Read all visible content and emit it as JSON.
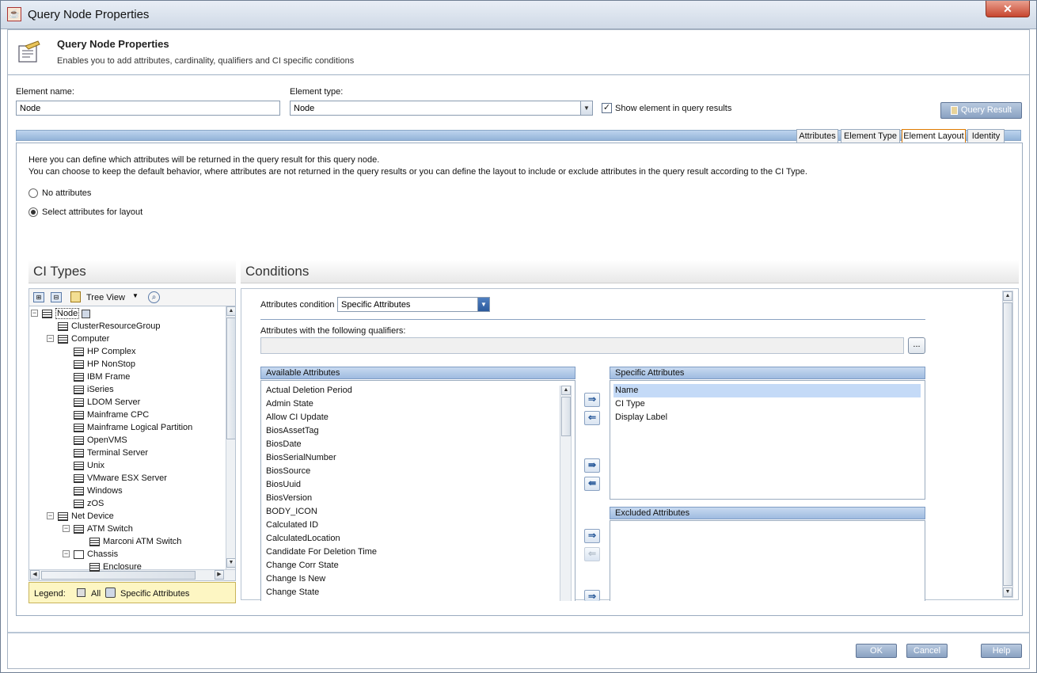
{
  "window": {
    "title": "Query Node Properties",
    "close_label": "✕"
  },
  "header": {
    "title": "Query Node Properties",
    "subtitle": "Enables you to add attributes, cardinality, qualifiers and CI specific conditions"
  },
  "form": {
    "element_name_label": "Element name:",
    "element_name_value": "Node",
    "element_type_label": "Element type:",
    "element_type_value": "Node",
    "show_in_results_label": "Show element in query results",
    "show_in_results_checked": true,
    "query_result_button": "Query Result"
  },
  "tabs": [
    {
      "label": "Attributes",
      "active": false
    },
    {
      "label": "Element Type",
      "active": false
    },
    {
      "label": "Element Layout",
      "active": true
    },
    {
      "label": "Identity",
      "active": false
    }
  ],
  "layout": {
    "description_line1": "Here you can define which attributes will be returned in the query result for this query node.",
    "description_line2": "You can choose to keep the default behavior, where attributes are not returned in the query results or you can define the layout to include or exclude attributes in the query result according to the CI Type.",
    "radio_no_attributes": "No attributes",
    "radio_select_attributes": "Select attributes for layout",
    "selected_option": "Select attributes for layout"
  },
  "ci_types": {
    "title": "CI Types",
    "tree_view_label": "Tree View",
    "items": [
      {
        "label": "Node",
        "level": 0,
        "expander": "−",
        "selected": true
      },
      {
        "label": "ClusterResourceGroup",
        "level": 1,
        "expander": ""
      },
      {
        "label": "Computer",
        "level": 1,
        "expander": "−"
      },
      {
        "label": "HP Complex",
        "level": 2,
        "expander": ""
      },
      {
        "label": "HP NonStop",
        "level": 2,
        "expander": ""
      },
      {
        "label": "IBM Frame",
        "level": 2,
        "expander": ""
      },
      {
        "label": "iSeries",
        "level": 2,
        "expander": ""
      },
      {
        "label": "LDOM Server",
        "level": 2,
        "expander": ""
      },
      {
        "label": "Mainframe CPC",
        "level": 2,
        "expander": ""
      },
      {
        "label": "Mainframe Logical Partition",
        "level": 2,
        "expander": ""
      },
      {
        "label": "OpenVMS",
        "level": 2,
        "expander": ""
      },
      {
        "label": "Terminal Server",
        "level": 2,
        "expander": ""
      },
      {
        "label": "Unix",
        "level": 2,
        "expander": ""
      },
      {
        "label": "VMware ESX Server",
        "level": 2,
        "expander": ""
      },
      {
        "label": "Windows",
        "level": 2,
        "expander": ""
      },
      {
        "label": "zOS",
        "level": 2,
        "expander": ""
      },
      {
        "label": "Net Device",
        "level": 1,
        "expander": "−"
      },
      {
        "label": "ATM Switch",
        "level": 2,
        "expander": "−"
      },
      {
        "label": "Marconi ATM Switch",
        "level": 3,
        "expander": ""
      },
      {
        "label": "Chassis",
        "level": 2,
        "expander": "−"
      },
      {
        "label": "Enclosure",
        "level": 3,
        "expander": ""
      }
    ],
    "legend_label": "Legend:",
    "legend_all": "All",
    "legend_specific": "Specific Attributes"
  },
  "conditions": {
    "title": "Conditions",
    "attributes_condition_label": "Attributes condition",
    "attributes_condition_value": "Specific Attributes",
    "qualifiers_label": "Attributes with the following qualifiers:",
    "qualifiers_button": "...",
    "available_header": "Available Attributes",
    "available": [
      "Actual Deletion Period",
      "Admin State",
      "Allow CI Update",
      "BiosAssetTag",
      "BiosDate",
      "BiosSerialNumber",
      "BiosSource",
      "BiosUuid",
      "BiosVersion",
      "BODY_ICON",
      "Calculated ID",
      "CalculatedLocation",
      "Candidate For Deletion Time",
      "Change Corr State",
      "Change Is New",
      "Change State"
    ],
    "specific_header": "Specific Attributes",
    "specific": [
      "Name",
      "CI Type",
      "Display Label"
    ],
    "excluded_header": "Excluded Attributes",
    "excluded": []
  },
  "footer": {
    "ok": "OK",
    "cancel": "Cancel",
    "help": "Help"
  }
}
